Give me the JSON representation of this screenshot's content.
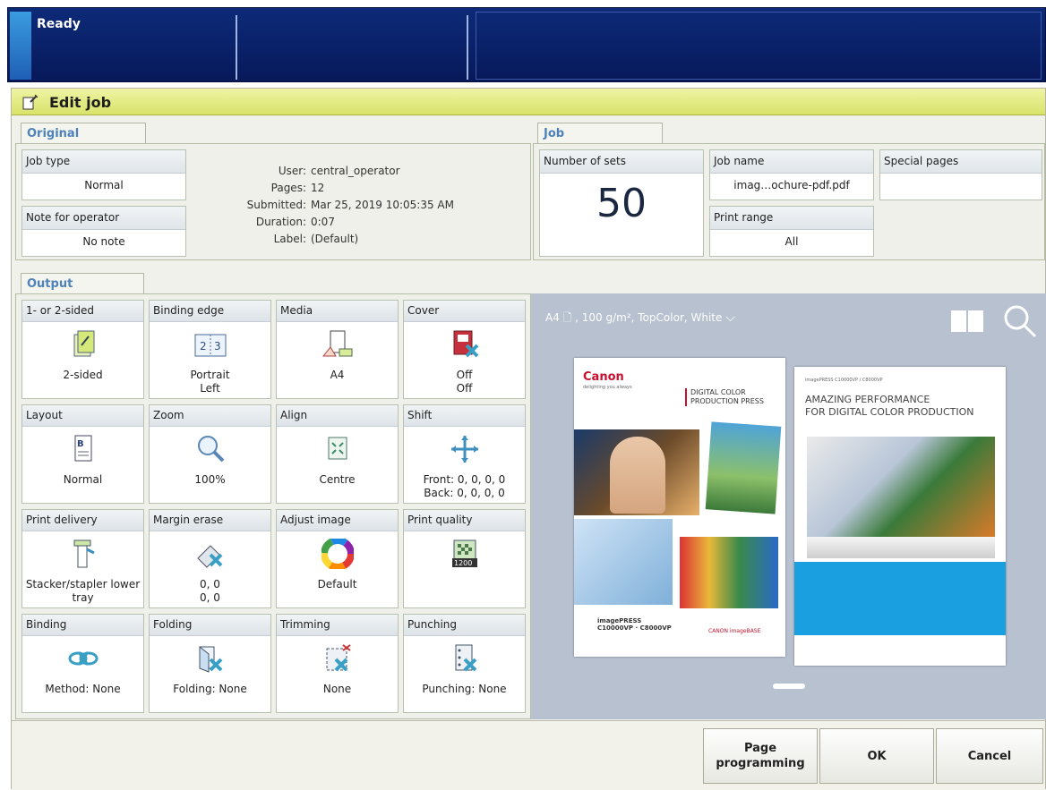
{
  "status": {
    "text": "Ready"
  },
  "window": {
    "title": "Edit job"
  },
  "original": {
    "tab": "Original",
    "job_type": {
      "label": "Job type",
      "value": "Normal"
    },
    "note": {
      "label": "Note for operator",
      "value": "No note"
    },
    "info": [
      {
        "key": "User:",
        "value": "central_operator"
      },
      {
        "key": "Pages:",
        "value": "12"
      },
      {
        "key": "Submitted:",
        "value": "Mar 25, 2019 10:05:35 AM"
      },
      {
        "key": "Duration:",
        "value": "0:07"
      },
      {
        "key": "Label:",
        "value": "(Default)"
      }
    ]
  },
  "job": {
    "tab": "Job",
    "sets": {
      "label": "Number of sets",
      "value": "50"
    },
    "name": {
      "label": "Job name",
      "value": "imag…ochure-pdf.pdf"
    },
    "range": {
      "label": "Print range",
      "value": "All"
    },
    "special": {
      "label": "Special pages",
      "value": ""
    }
  },
  "output": {
    "tab": "Output",
    "tiles": [
      {
        "label": "1- or 2-sided",
        "value": "2-sided",
        "icon": "duplex-icon"
      },
      {
        "label": "Binding edge",
        "value": "Portrait\nLeft",
        "icon": "binding-edge-icon"
      },
      {
        "label": "Media",
        "value": "A4",
        "icon": "media-icon"
      },
      {
        "label": "Cover",
        "value": "Off\nOff",
        "icon": "cover-icon"
      },
      {
        "label": "Layout",
        "value": "Normal",
        "icon": "layout-icon"
      },
      {
        "label": "Zoom",
        "value": "100%",
        "icon": "zoom-icon"
      },
      {
        "label": "Align",
        "value": "Centre",
        "icon": "align-icon"
      },
      {
        "label": "Shift",
        "value": "Front: 0, 0, 0, 0\nBack: 0, 0, 0, 0",
        "icon": "shift-icon"
      },
      {
        "label": "Print delivery",
        "value": "Stacker/stapler lower\ntray",
        "icon": "print-delivery-icon"
      },
      {
        "label": "Margin erase",
        "value": "0, 0\n0, 0",
        "icon": "margin-erase-icon"
      },
      {
        "label": "Adjust image",
        "value": "Default",
        "icon": "color-wheel-icon"
      },
      {
        "label": "Print quality",
        "value": "",
        "icon": "print-quality-icon"
      },
      {
        "label": "Binding",
        "value": "Method: None",
        "icon": "binding-icon"
      },
      {
        "label": "Folding",
        "value": "Folding: None",
        "icon": "folding-icon"
      },
      {
        "label": "Trimming",
        "value": "None",
        "icon": "trimming-icon"
      },
      {
        "label": "Punching",
        "value": "Punching: None",
        "icon": "punching-icon"
      }
    ]
  },
  "preview": {
    "media": "A4",
    "media_detail": ", 100 g/m², TopColor, White",
    "quality_badge": "1200",
    "page1": {
      "brand": "Canon",
      "brand_sub": "delighting you always",
      "headline": "DIGITAL COLOR\nPRODUCTION PRESS",
      "product": "imagePRESS\nC10000VP · C8000VP",
      "footer": "CANON imageBASE"
    },
    "page2": {
      "topline": "imagePRESS C10000VP / C8000VP",
      "headline": "AMAZING PERFORMANCE\nFOR DIGITAL COLOR PRODUCTION"
    }
  },
  "buttons": {
    "page_programming": "Page\nprogramming",
    "ok": "OK",
    "cancel": "Cancel"
  },
  "colors": {
    "topbar": "#0d2a78",
    "titlebar": "#e3ea86",
    "accent_text": "#4e82b8",
    "preview_bg": "#b7c1cf"
  }
}
